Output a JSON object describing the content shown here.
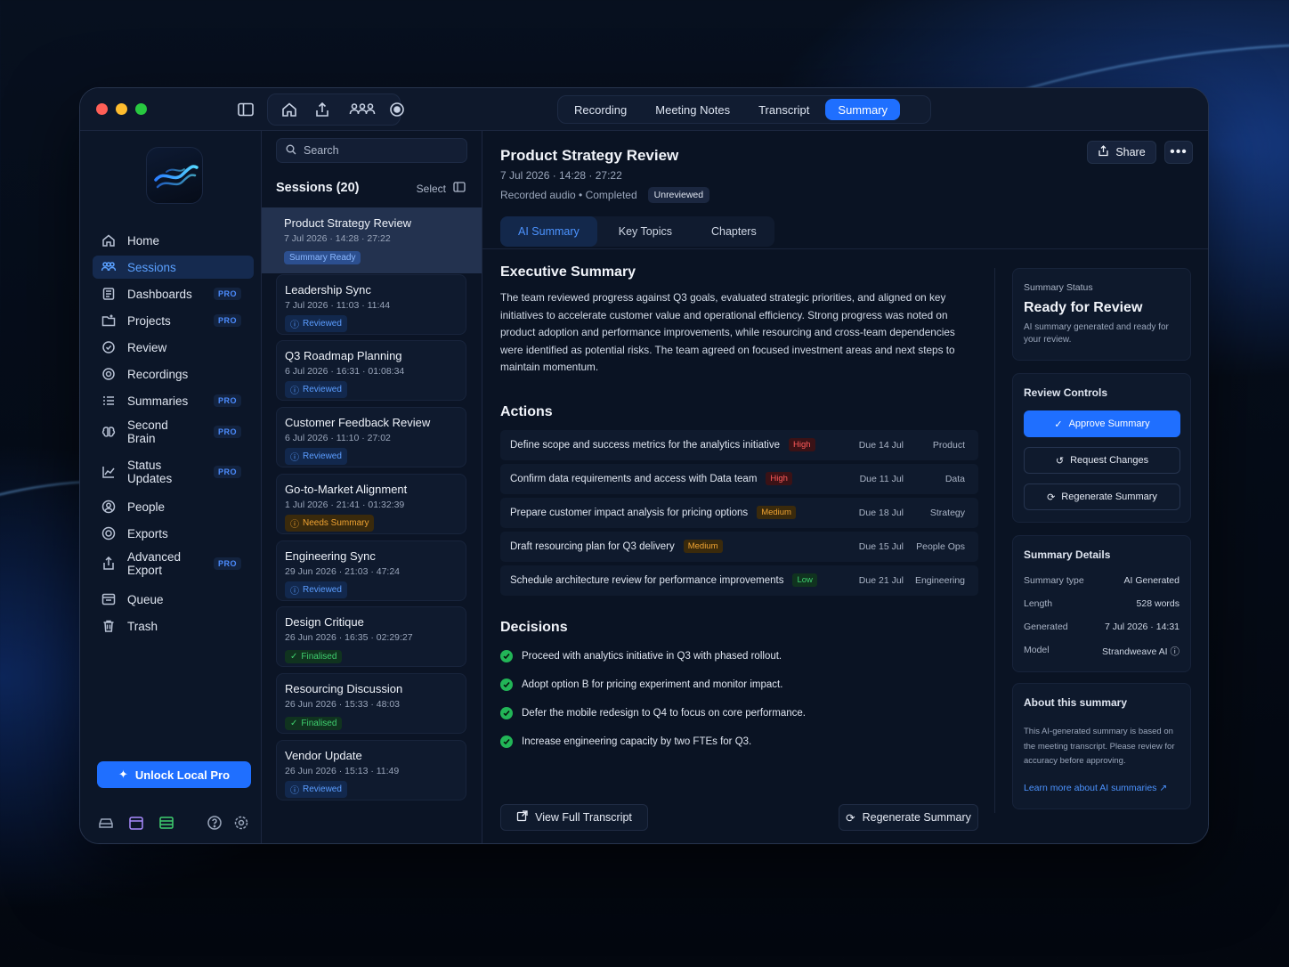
{
  "titlebar": {
    "segments": [
      {
        "label": "Recording",
        "active": false
      },
      {
        "label": "Meeting Notes",
        "active": false
      },
      {
        "label": "Transcript",
        "active": false
      },
      {
        "label": "Summary",
        "active": true
      }
    ]
  },
  "sidebar": {
    "items": [
      {
        "label": "Home",
        "icon": "home-icon",
        "pro": ""
      },
      {
        "label": "Sessions",
        "icon": "people-icon",
        "pro": ""
      },
      {
        "label": "Dashboards",
        "icon": "dashboard-icon",
        "pro": "PRO"
      },
      {
        "label": "Projects",
        "icon": "folder-icon",
        "pro": "PRO"
      },
      {
        "label": "Review",
        "icon": "check-circle-icon",
        "pro": ""
      },
      {
        "label": "Recordings",
        "icon": "record-icon",
        "pro": ""
      },
      {
        "label": "Summaries",
        "icon": "list-icon",
        "pro": "PRO"
      },
      {
        "label": "Second Brain",
        "icon": "brain-icon",
        "pro": "PRO"
      },
      {
        "label": "Status Updates",
        "icon": "chart-icon",
        "pro": "PRO"
      },
      {
        "label": "People",
        "icon": "person-icon",
        "pro": ""
      },
      {
        "label": "Exports",
        "icon": "export-icon",
        "pro": ""
      },
      {
        "label": "Advanced Export",
        "icon": "advanced-export-icon",
        "pro": "PRO"
      },
      {
        "label": "Queue",
        "icon": "queue-icon",
        "pro": ""
      },
      {
        "label": "Trash",
        "icon": "trash-icon",
        "pro": ""
      }
    ],
    "unlock_label": "Unlock Local Pro"
  },
  "sessions": {
    "search_placeholder": "Search",
    "title": "Sessions (20)",
    "select_label": "Select",
    "items": [
      {
        "title": "Product Strategy Review",
        "meta": "7 Jul 2026 · 14:28 · 27:22",
        "status": "Summary Ready",
        "kind": "sel"
      },
      {
        "title": "Leadership Sync",
        "meta": "7 Jul 2026 · 11:03 · 11:44",
        "status": "Reviewed",
        "kind": "blue"
      },
      {
        "title": "Q3 Roadmap Planning",
        "meta": "6 Jul 2026 · 16:31 · 01:08:34",
        "status": "Reviewed",
        "kind": "blue"
      },
      {
        "title": "Customer Feedback Review",
        "meta": "6 Jul 2026 · 11:10 · 27:02",
        "status": "Reviewed",
        "kind": "blue"
      },
      {
        "title": "Go-to-Market Alignment",
        "meta": "1 Jul 2026 · 21:41 · 01:32:39",
        "status": "Needs Summary",
        "kind": "gold"
      },
      {
        "title": "Engineering Sync",
        "meta": "29 Jun 2026 · 21:03 · 47:24",
        "status": "Reviewed",
        "kind": "blue"
      },
      {
        "title": "Design Critique",
        "meta": "26 Jun 2026 · 16:35 · 02:29:27",
        "status": "Finalised",
        "kind": "green"
      },
      {
        "title": "Resourcing Discussion",
        "meta": "26 Jun 2026 · 15:33 · 48:03",
        "status": "Finalised",
        "kind": "green"
      },
      {
        "title": "Vendor Update",
        "meta": "26 Jun 2026 · 15:13 · 11:49",
        "status": "Reviewed",
        "kind": "blue"
      }
    ]
  },
  "main": {
    "title": "Product Strategy Review",
    "meta": "7 Jul 2026 · 14:28 · 27:22",
    "meta2": "Recorded audio • Completed",
    "badge": "Unreviewed",
    "share_label": "Share",
    "tabs": [
      "AI Summary",
      "Key Topics",
      "Chapters"
    ],
    "exec_title": "Executive Summary",
    "exec_text": "The team reviewed progress against Q3 goals, evaluated strategic priorities, and aligned on key initiatives to accelerate customer value and operational efficiency. Strong progress was noted on product adoption and performance improvements, while resourcing and cross-team dependencies were identified as potential risks. The team agreed on focused investment areas and next steps to maintain momentum.",
    "actions_title": "Actions",
    "actions": [
      {
        "text": "Define scope and success metrics for the analytics initiative",
        "priority": "High",
        "level": "high",
        "due": "Due 14 Jul",
        "owner": "Product"
      },
      {
        "text": "Confirm data requirements and access with Data team",
        "priority": "High",
        "level": "high",
        "due": "Due 11 Jul",
        "owner": "Data"
      },
      {
        "text": "Prepare customer impact analysis for pricing options",
        "priority": "Medium",
        "level": "med",
        "due": "Due 18 Jul",
        "owner": "Strategy"
      },
      {
        "text": "Draft resourcing plan for Q3 delivery",
        "priority": "Medium",
        "level": "med",
        "due": "Due 15 Jul",
        "owner": "People Ops"
      },
      {
        "text": "Schedule architecture review for performance improvements",
        "priority": "Low",
        "level": "low",
        "due": "Due 21 Jul",
        "owner": "Engineering"
      }
    ],
    "decisions_title": "Decisions",
    "decisions": [
      "Proceed with analytics initiative in Q3 with phased rollout.",
      "Adopt option B for pricing experiment and monitor impact.",
      "Defer the mobile redesign to Q4 to focus on core performance.",
      "Increase engineering capacity by two FTEs for Q3."
    ],
    "view_transcript_label": "View Full Transcript",
    "regenerate_label": "Regenerate Summary"
  },
  "right": {
    "status_label": "Summary Status",
    "status_title": "Ready for Review",
    "status_desc": "AI summary generated and ready for your review.",
    "controls_title": "Review Controls",
    "approve_label": "Approve Summary",
    "request_label": "Request Changes",
    "regen_label": "Regenerate Summary",
    "details_title": "Summary Details",
    "details": [
      {
        "k": "Summary type",
        "v": "AI Generated"
      },
      {
        "k": "Length",
        "v": "528 words"
      },
      {
        "k": "Generated",
        "v": "7 Jul 2026 · 14:31"
      },
      {
        "k": "Model",
        "v": "Strandweave AI"
      }
    ],
    "about_title": "About this summary",
    "about_text": "This AI-generated summary is based on the meeting transcript. Please review for accuracy before approving.",
    "about_link": "Learn more about AI summaries"
  },
  "colors": {
    "accent": "#1f6fff",
    "high": "#ff5a5a",
    "medium": "#f0a332",
    "low": "#3fcf6f"
  }
}
